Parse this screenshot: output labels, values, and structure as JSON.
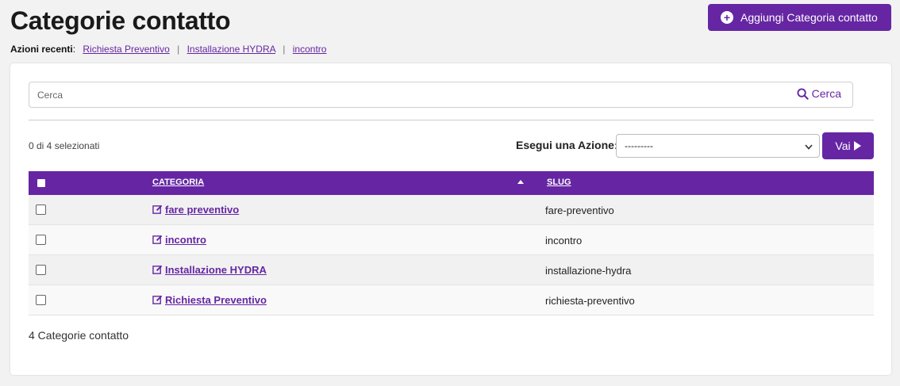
{
  "page": {
    "title": "Categorie contatto",
    "add_button_label": "Aggiungi Categoria contatto"
  },
  "recent": {
    "label": "Azioni recenti",
    "items": [
      "Richiesta Preventivo",
      "Installazione HYDRA",
      "incontro"
    ]
  },
  "search": {
    "placeholder": "Cerca",
    "button_label": "Cerca"
  },
  "actions": {
    "selected_count": "0 di 4 selezionati",
    "label": "Esegui una Azione:",
    "select_value": "---------",
    "go_label": "Vai"
  },
  "table": {
    "columns": [
      "CATEGORIA",
      "SLUG"
    ],
    "rows": [
      {
        "categoria": "fare preventivo",
        "slug": "fare-preventivo"
      },
      {
        "categoria": "incontro",
        "slug": "incontro"
      },
      {
        "categoria": "Installazione HYDRA",
        "slug": "installazione-hydra"
      },
      {
        "categoria": "Richiesta Preventivo",
        "slug": "richiesta-preventivo"
      }
    ]
  },
  "footer": {
    "count_text": "4 Categorie contatto"
  },
  "colors": {
    "accent": "#6626a3"
  },
  "icons": {
    "add": "plus-circle-icon",
    "search": "search-icon",
    "edit": "edit-icon",
    "sort": "sort-asc-icon",
    "go": "play-icon",
    "dropdown": "chevron-down-icon"
  }
}
